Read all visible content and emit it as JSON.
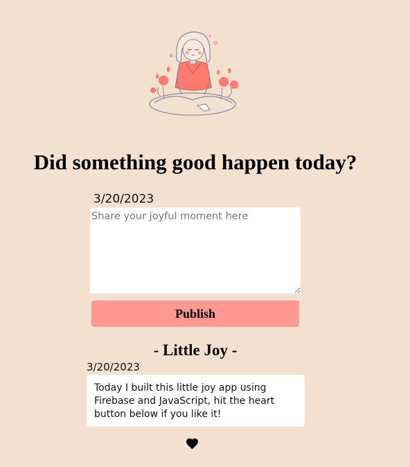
{
  "header": {
    "illustration": "girl-meditating-with-flowers",
    "title": "Did something good happen today?"
  },
  "composer": {
    "date": "3/20/2023",
    "input_value": "",
    "input_placeholder": "Share your joyful moment here",
    "publish_label": "Publish"
  },
  "feed": {
    "title": "- Little Joy -",
    "posts": [
      {
        "date": "3/20/2023",
        "text": "Today I built this little joy app using Firebase and JavaScript, hit the heart button below if you like it!"
      }
    ]
  },
  "like": {
    "icon": "heart-icon"
  },
  "colors": {
    "background": "#f3e0cf",
    "button": "#ff9991",
    "accent_shirt": "#ff7a6e",
    "card": "#ffffff"
  }
}
